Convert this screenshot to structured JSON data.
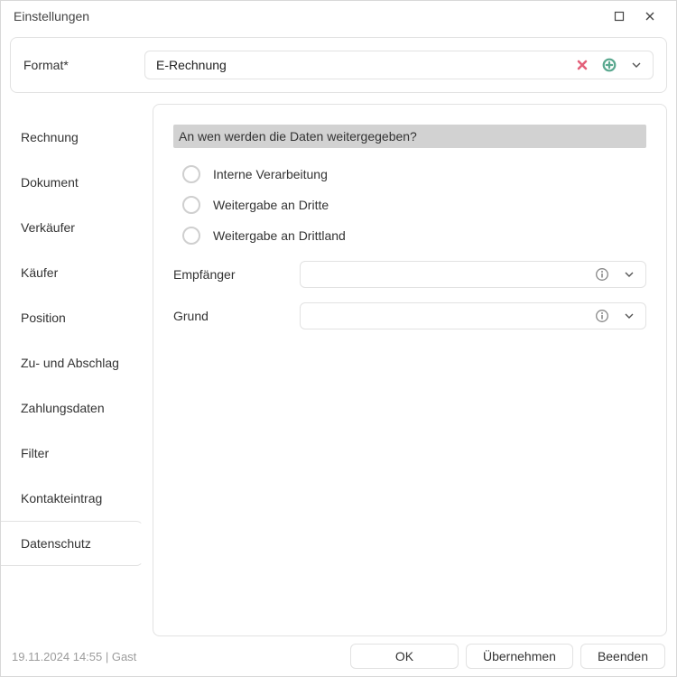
{
  "window": {
    "title": "Einstellungen"
  },
  "format": {
    "label": "Format*",
    "value": "E-Rechnung"
  },
  "tabs": [
    {
      "label": "Rechnung"
    },
    {
      "label": "Dokument"
    },
    {
      "label": "Verkäufer"
    },
    {
      "label": "Käufer"
    },
    {
      "label": "Position"
    },
    {
      "label": "Zu- und Abschlag"
    },
    {
      "label": "Zahlungsdaten"
    },
    {
      "label": "Filter"
    },
    {
      "label": "Kontakteintrag"
    },
    {
      "label": "Datenschutz"
    }
  ],
  "active_tab_index": 9,
  "panel": {
    "section_title": "An wen werden die Daten weitergegeben?",
    "radios": [
      {
        "label": "Interne Verarbeitung"
      },
      {
        "label": "Weitergabe an Dritte"
      },
      {
        "label": "Weitergabe an Drittland"
      }
    ],
    "fields": {
      "empfaenger_label": "Empfänger",
      "grund_label": "Grund"
    }
  },
  "footer": {
    "status": "19.11.2024 14:55 | Gast",
    "ok": "OK",
    "apply": "Übernehmen",
    "close": "Beenden"
  }
}
